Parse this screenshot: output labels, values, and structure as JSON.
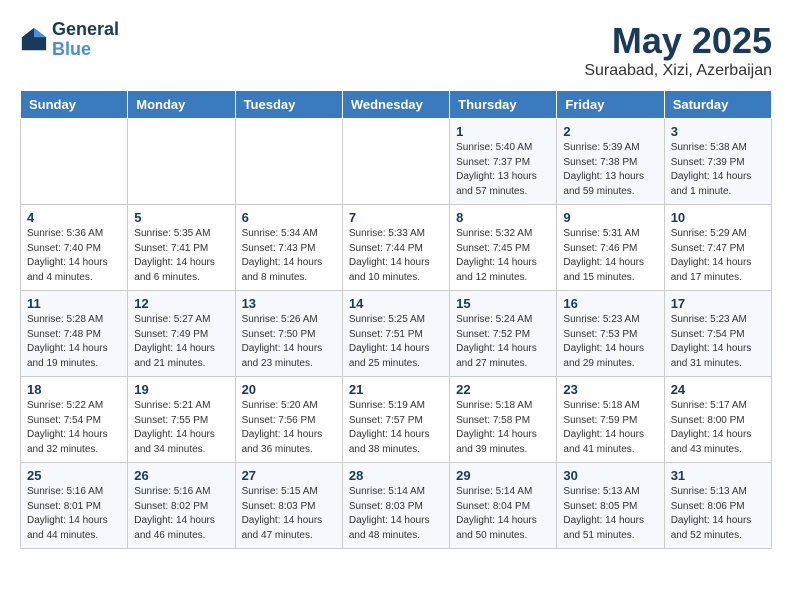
{
  "header": {
    "logo_line1": "General",
    "logo_line2": "Blue",
    "month_year": "May 2025",
    "location": "Suraabad, Xizi, Azerbaijan"
  },
  "days_of_week": [
    "Sunday",
    "Monday",
    "Tuesday",
    "Wednesday",
    "Thursday",
    "Friday",
    "Saturday"
  ],
  "weeks": [
    [
      {
        "day": "",
        "sunrise": "",
        "sunset": "",
        "daylight": ""
      },
      {
        "day": "",
        "sunrise": "",
        "sunset": "",
        "daylight": ""
      },
      {
        "day": "",
        "sunrise": "",
        "sunset": "",
        "daylight": ""
      },
      {
        "day": "",
        "sunrise": "",
        "sunset": "",
        "daylight": ""
      },
      {
        "day": "1",
        "sunrise": "Sunrise: 5:40 AM",
        "sunset": "Sunset: 7:37 PM",
        "daylight": "Daylight: 13 hours and 57 minutes."
      },
      {
        "day": "2",
        "sunrise": "Sunrise: 5:39 AM",
        "sunset": "Sunset: 7:38 PM",
        "daylight": "Daylight: 13 hours and 59 minutes."
      },
      {
        "day": "3",
        "sunrise": "Sunrise: 5:38 AM",
        "sunset": "Sunset: 7:39 PM",
        "daylight": "Daylight: 14 hours and 1 minute."
      }
    ],
    [
      {
        "day": "4",
        "sunrise": "Sunrise: 5:36 AM",
        "sunset": "Sunset: 7:40 PM",
        "daylight": "Daylight: 14 hours and 4 minutes."
      },
      {
        "day": "5",
        "sunrise": "Sunrise: 5:35 AM",
        "sunset": "Sunset: 7:41 PM",
        "daylight": "Daylight: 14 hours and 6 minutes."
      },
      {
        "day": "6",
        "sunrise": "Sunrise: 5:34 AM",
        "sunset": "Sunset: 7:43 PM",
        "daylight": "Daylight: 14 hours and 8 minutes."
      },
      {
        "day": "7",
        "sunrise": "Sunrise: 5:33 AM",
        "sunset": "Sunset: 7:44 PM",
        "daylight": "Daylight: 14 hours and 10 minutes."
      },
      {
        "day": "8",
        "sunrise": "Sunrise: 5:32 AM",
        "sunset": "Sunset: 7:45 PM",
        "daylight": "Daylight: 14 hours and 12 minutes."
      },
      {
        "day": "9",
        "sunrise": "Sunrise: 5:31 AM",
        "sunset": "Sunset: 7:46 PM",
        "daylight": "Daylight: 14 hours and 15 minutes."
      },
      {
        "day": "10",
        "sunrise": "Sunrise: 5:29 AM",
        "sunset": "Sunset: 7:47 PM",
        "daylight": "Daylight: 14 hours and 17 minutes."
      }
    ],
    [
      {
        "day": "11",
        "sunrise": "Sunrise: 5:28 AM",
        "sunset": "Sunset: 7:48 PM",
        "daylight": "Daylight: 14 hours and 19 minutes."
      },
      {
        "day": "12",
        "sunrise": "Sunrise: 5:27 AM",
        "sunset": "Sunset: 7:49 PM",
        "daylight": "Daylight: 14 hours and 21 minutes."
      },
      {
        "day": "13",
        "sunrise": "Sunrise: 5:26 AM",
        "sunset": "Sunset: 7:50 PM",
        "daylight": "Daylight: 14 hours and 23 minutes."
      },
      {
        "day": "14",
        "sunrise": "Sunrise: 5:25 AM",
        "sunset": "Sunset: 7:51 PM",
        "daylight": "Daylight: 14 hours and 25 minutes."
      },
      {
        "day": "15",
        "sunrise": "Sunrise: 5:24 AM",
        "sunset": "Sunset: 7:52 PM",
        "daylight": "Daylight: 14 hours and 27 minutes."
      },
      {
        "day": "16",
        "sunrise": "Sunrise: 5:23 AM",
        "sunset": "Sunset: 7:53 PM",
        "daylight": "Daylight: 14 hours and 29 minutes."
      },
      {
        "day": "17",
        "sunrise": "Sunrise: 5:23 AM",
        "sunset": "Sunset: 7:54 PM",
        "daylight": "Daylight: 14 hours and 31 minutes."
      }
    ],
    [
      {
        "day": "18",
        "sunrise": "Sunrise: 5:22 AM",
        "sunset": "Sunset: 7:54 PM",
        "daylight": "Daylight: 14 hours and 32 minutes."
      },
      {
        "day": "19",
        "sunrise": "Sunrise: 5:21 AM",
        "sunset": "Sunset: 7:55 PM",
        "daylight": "Daylight: 14 hours and 34 minutes."
      },
      {
        "day": "20",
        "sunrise": "Sunrise: 5:20 AM",
        "sunset": "Sunset: 7:56 PM",
        "daylight": "Daylight: 14 hours and 36 minutes."
      },
      {
        "day": "21",
        "sunrise": "Sunrise: 5:19 AM",
        "sunset": "Sunset: 7:57 PM",
        "daylight": "Daylight: 14 hours and 38 minutes."
      },
      {
        "day": "22",
        "sunrise": "Sunrise: 5:18 AM",
        "sunset": "Sunset: 7:58 PM",
        "daylight": "Daylight: 14 hours and 39 minutes."
      },
      {
        "day": "23",
        "sunrise": "Sunrise: 5:18 AM",
        "sunset": "Sunset: 7:59 PM",
        "daylight": "Daylight: 14 hours and 41 minutes."
      },
      {
        "day": "24",
        "sunrise": "Sunrise: 5:17 AM",
        "sunset": "Sunset: 8:00 PM",
        "daylight": "Daylight: 14 hours and 43 minutes."
      }
    ],
    [
      {
        "day": "25",
        "sunrise": "Sunrise: 5:16 AM",
        "sunset": "Sunset: 8:01 PM",
        "daylight": "Daylight: 14 hours and 44 minutes."
      },
      {
        "day": "26",
        "sunrise": "Sunrise: 5:16 AM",
        "sunset": "Sunset: 8:02 PM",
        "daylight": "Daylight: 14 hours and 46 minutes."
      },
      {
        "day": "27",
        "sunrise": "Sunrise: 5:15 AM",
        "sunset": "Sunset: 8:03 PM",
        "daylight": "Daylight: 14 hours and 47 minutes."
      },
      {
        "day": "28",
        "sunrise": "Sunrise: 5:14 AM",
        "sunset": "Sunset: 8:03 PM",
        "daylight": "Daylight: 14 hours and 48 minutes."
      },
      {
        "day": "29",
        "sunrise": "Sunrise: 5:14 AM",
        "sunset": "Sunset: 8:04 PM",
        "daylight": "Daylight: 14 hours and 50 minutes."
      },
      {
        "day": "30",
        "sunrise": "Sunrise: 5:13 AM",
        "sunset": "Sunset: 8:05 PM",
        "daylight": "Daylight: 14 hours and 51 minutes."
      },
      {
        "day": "31",
        "sunrise": "Sunrise: 5:13 AM",
        "sunset": "Sunset: 8:06 PM",
        "daylight": "Daylight: 14 hours and 52 minutes."
      }
    ]
  ]
}
